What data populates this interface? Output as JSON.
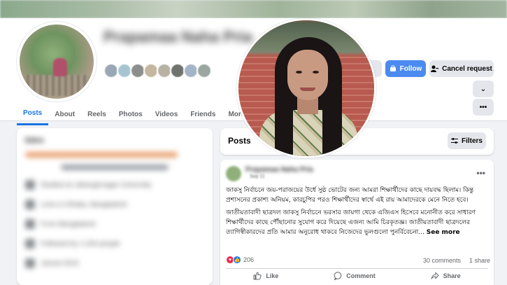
{
  "profile": {
    "name": "Prapamaa Naha Pria",
    "friend_avatars": [
      "#9aa8b5",
      "#a7c5d1",
      "#8b8e8a",
      "#c4b79f",
      "#b8b2a3",
      "#6f726d",
      "#a3b4c8",
      "#9aa6a0"
    ]
  },
  "buttons": {
    "manage": "age",
    "follow": "Follow",
    "cancel_request": "Cancel request",
    "chevron": "⌄",
    "more": "•••"
  },
  "tabs": [
    "Posts",
    "About",
    "Reels",
    "Photos",
    "Videos",
    "Friends",
    "More"
  ],
  "posts_section": {
    "title": "Posts",
    "filters_label": "Filters"
  },
  "post": {
    "author": "Prapamaa Naha Pria",
    "time": "Sep 11",
    "paragraph_1": "জাকসু নির্বাচনে জয়-পরাজয়ের উর্ধে সুষ্ঠ ভোটের জন্য আমরা শিক্ষার্থীদের কাছে দায়বদ্ধ ছিলাম। কিন্তু প্রশাসনের প্রকাশ্য অনিয়ম, কারচুপির পরও শিক্ষার্থীদের স্বার্থে এই রায় আমাদেরকে মেনে নিতে হবে।",
    "paragraph_2": "জাতীয়তাবাদী ছাত্রদল জাকসু নির্বাচনে ভরসার জায়গা থেকে এজিএস হিসেবে মনোনীত করে সাধারণ শিক্ষার্থীদের কাছে পৌঁছানোর সুযোগ করে দিয়েছে এজন্য আমি চিরকৃতজ্ঞ। জাতীয়তাবাদী ছাত্রদলের ত্যাগিস্বীকারদের প্রতি আমার অনুরোধ থাকবে নিজেদের ভুলগুলো পুনর্বিবেচনা... ",
    "see_more": "See more",
    "reaction_count": "206",
    "comments": "30 comments",
    "shares": "1 share",
    "actions": {
      "like": "Like",
      "comment": "Comment",
      "share": "Share"
    }
  },
  "left_panel": {
    "heading": "Intro",
    "lines": [
      "Studied at Jahangirnagar University",
      "Lives in Dhaka, Bangladesh",
      "From Bangladesh",
      "Followed by 1,234 people",
      "Joined 2015"
    ]
  },
  "colors": {
    "accent": "#1b74e4",
    "follow_button": "#4b8bf0",
    "background": "#f0f2f5"
  }
}
